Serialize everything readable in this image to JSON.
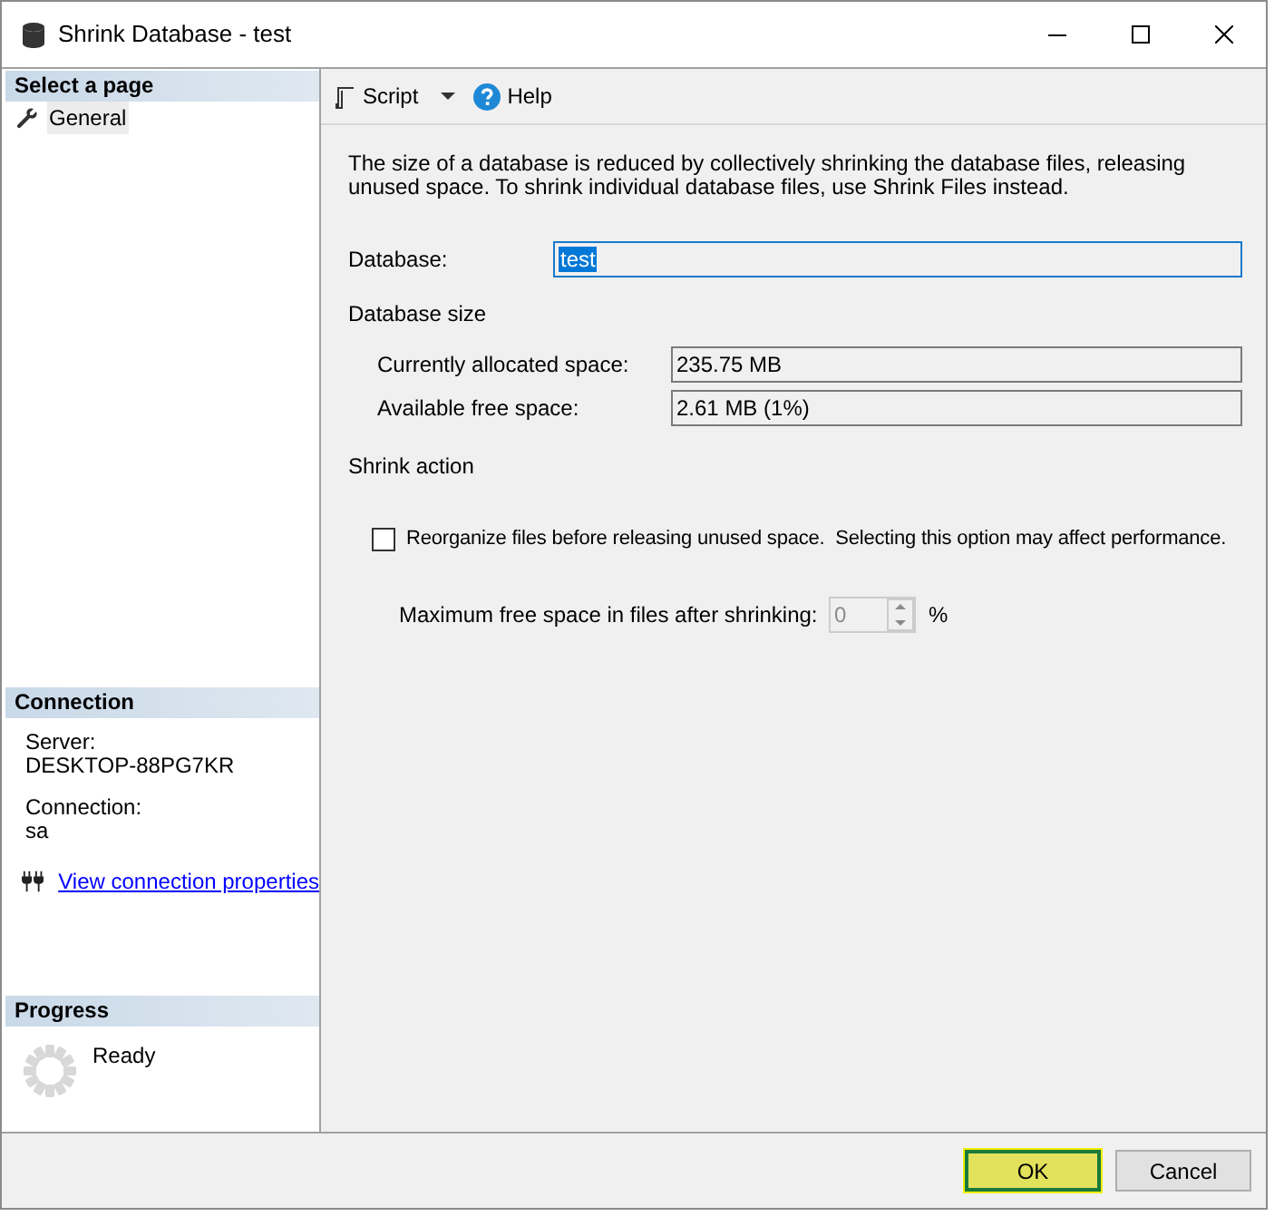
{
  "window": {
    "title": "Shrink Database - test"
  },
  "sidebar": {
    "pages_header": "Select a page",
    "pages": [
      {
        "label": "General",
        "selected": true
      }
    ],
    "connection_header": "Connection",
    "connection_fields": [
      {
        "label": "Server:",
        "value": "DESKTOP-88PG7KR"
      },
      {
        "label": "Connection:",
        "value": "sa"
      }
    ],
    "connection_link": "View connection properties",
    "progress_header": "Progress",
    "progress_status": "Ready"
  },
  "toolbar": {
    "script": "Script",
    "help": "Help"
  },
  "description": "The size of a database is reduced by collectively shrinking the database files, releasing unused space. To shrink individual database files, use Shrink Files instead.",
  "database": {
    "label": "Database:",
    "value": "test"
  },
  "size_header": "Database size",
  "size_fields": [
    {
      "label": "Currently allocated space:",
      "value": "235.75 MB"
    },
    {
      "label": "Available free space:",
      "value": "2.61 MB (1%)"
    }
  ],
  "shrink_header": "Shrink action",
  "reorganize": {
    "label": "Reorganize files before releasing unused space.  Selecting this option may affect performance.",
    "checked": false
  },
  "max_free": {
    "label": "Maximum free space in files after shrinking:",
    "value": "0",
    "unit": "%",
    "disabled": true
  },
  "buttons": [
    {
      "label": "OK",
      "kind": "default"
    },
    {
      "label": "Cancel",
      "kind": "normal"
    }
  ]
}
